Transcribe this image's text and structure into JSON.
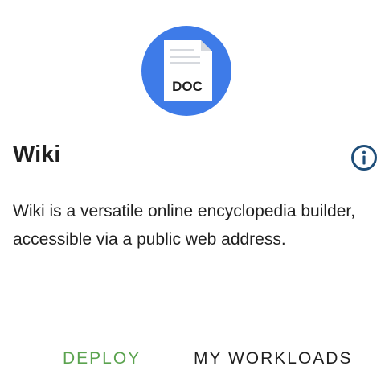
{
  "card": {
    "title": "Wiki",
    "description": "Wiki is a versatile online encyclopedia builder, accessible via a public web address.",
    "logo": {
      "icon": "document-icon",
      "label": "DOC",
      "background_color": "#3e7be8"
    },
    "info_icon": "info-circle-icon",
    "actions": {
      "deploy_label": "DEPLOY",
      "workloads_label": "MY WORKLOADS"
    },
    "colors": {
      "accent": "#5ba34f",
      "info": "#1f4e79",
      "text": "#1f1f1f"
    }
  }
}
